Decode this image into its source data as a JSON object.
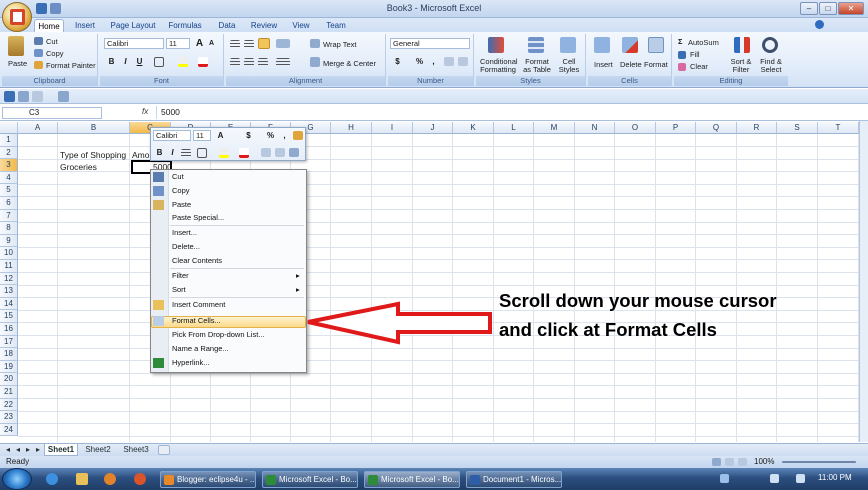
{
  "window": {
    "title": "Book3 - Microsoft Excel",
    "min": "–",
    "max": "□",
    "close": "✕"
  },
  "tabs": [
    "Home",
    "Insert",
    "Page Layout",
    "Formulas",
    "Data",
    "Review",
    "View",
    "Team"
  ],
  "ribbon": {
    "clipboard": {
      "paste": "Paste",
      "cut": "Cut",
      "copy": "Copy",
      "format_painter": "Format Painter",
      "label": "Clipboard"
    },
    "font": {
      "name": "Calibri",
      "size": "11",
      "grow": "A",
      "shrink": "A",
      "bold": "B",
      "italic": "I",
      "underline": "U",
      "label": "Font"
    },
    "alignment": {
      "wrap": "Wrap Text",
      "merge": "Merge & Center",
      "label": "Alignment"
    },
    "number": {
      "format": "General",
      "currency": "$",
      "percent": "%",
      "comma": ",",
      "label": "Number"
    },
    "styles": {
      "conditional": "Conditional Formatting",
      "as_table": "Format as Table",
      "cell_styles": "Cell Styles",
      "label": "Styles"
    },
    "cells": {
      "insert": "Insert",
      "delete": "Delete",
      "format": "Format",
      "label": "Cells"
    },
    "editing": {
      "autosum": "AutoSum",
      "fill": "Fill",
      "clear": "Clear",
      "sort": "Sort & Filter",
      "find": "Find & Select",
      "label": "Editing"
    }
  },
  "formula_bar": {
    "name_box": "C3",
    "fx": "fx",
    "value": "5000"
  },
  "columns": [
    "A",
    "B",
    "C",
    "D",
    "E",
    "F",
    "G",
    "H",
    "I",
    "J",
    "K",
    "L",
    "M",
    "N",
    "O",
    "P",
    "Q",
    "R",
    "S",
    "T"
  ],
  "rows": [
    "1",
    "2",
    "3",
    "4",
    "5",
    "6",
    "7",
    "8",
    "9",
    "10",
    "11",
    "12",
    "13",
    "14",
    "15",
    "16",
    "17",
    "18",
    "19",
    "20",
    "21",
    "22",
    "23",
    "24"
  ],
  "cells": {
    "B2": "Type of Shopping",
    "C2": "Amo",
    "B3": "Groceries",
    "C3": "5000"
  },
  "mini_toolbar": {
    "font": "Calibri",
    "size": "11",
    "currency": "$",
    "percent": "%",
    "comma": ","
  },
  "context_menu": {
    "items": [
      "Cut",
      "Copy",
      "Paste",
      "Paste Special...",
      "Insert...",
      "Delete...",
      "Clear Contents",
      "Filter",
      "Sort",
      "Insert Comment",
      "Format Cells...",
      "Pick From Drop-down List...",
      "Name a Range...",
      "Hyperlink..."
    ],
    "arrow": "▸"
  },
  "callout": {
    "text": "Scroll down your mouse cursor and click at Format Cells"
  },
  "sheets": [
    "Sheet1",
    "Sheet2",
    "Sheet3"
  ],
  "status": {
    "ready": "Ready",
    "zoom": "100%"
  },
  "taskbar": {
    "items": [
      "Blogger: eclipse4u - ...",
      "Microsoft Excel - Bo...",
      "Microsoft Excel - Bo...",
      "Document1 - Micros..."
    ],
    "clock": "11:00 PM"
  },
  "colors": {
    "accent": "#15428b",
    "arrow": "#e01a1a",
    "highlight": "#fbd98a"
  }
}
